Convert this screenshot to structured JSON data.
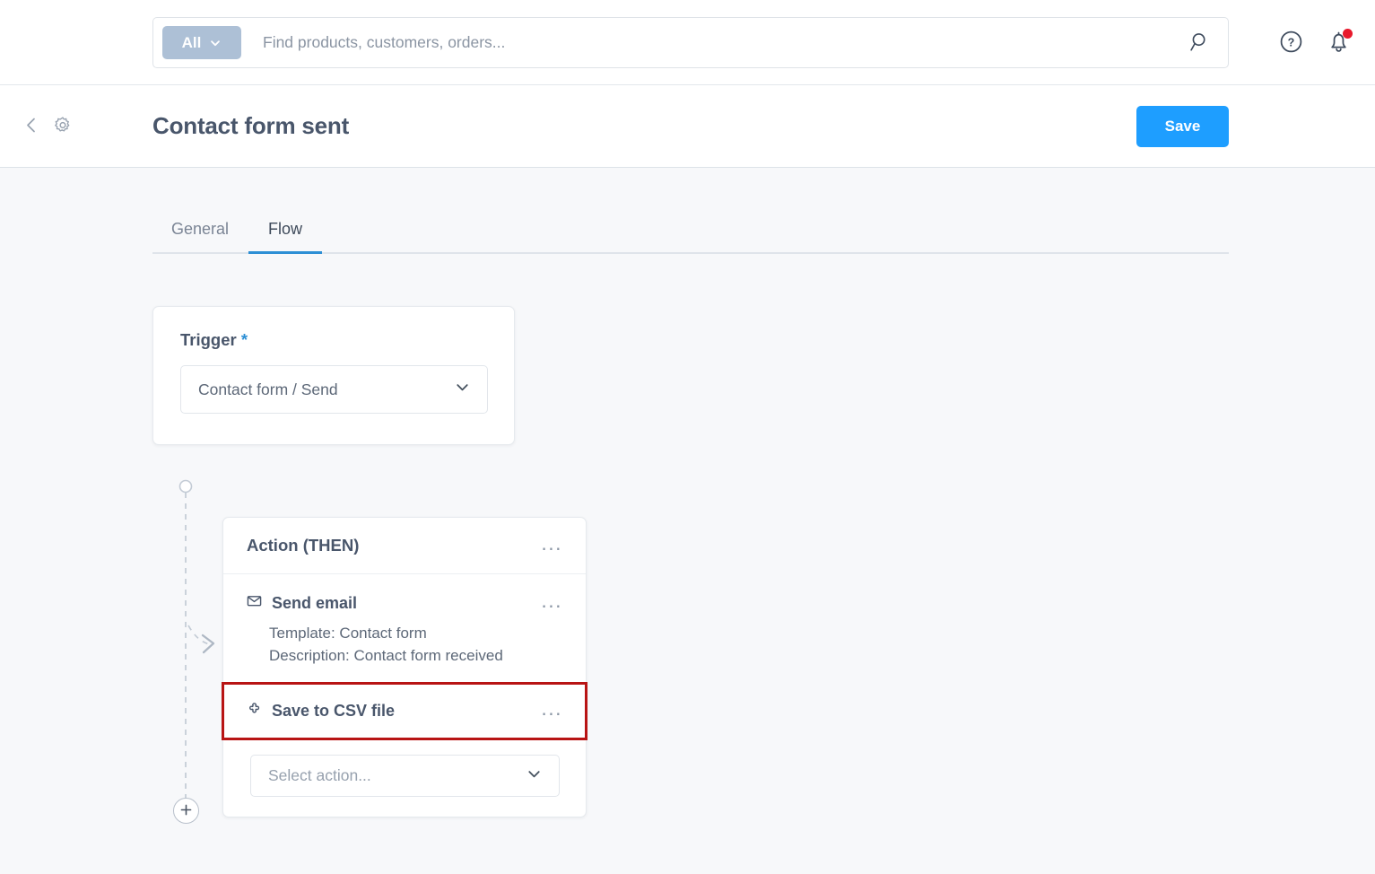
{
  "topbar": {
    "scope_label": "All",
    "scope_chevron_icon": "chevron-down-icon",
    "search_placeholder": "Find products, customers, orders...",
    "search_value": "",
    "search_icon": "search-icon",
    "help_icon": "help-circle-icon",
    "notifications_icon": "bell-icon",
    "notification_badge": ""
  },
  "pagehead": {
    "back_icon": "chevron-left-icon",
    "settings_icon": "gear-icon",
    "title": "Contact form sent",
    "save_label": "Save",
    "save_color": "#1e9eff"
  },
  "tabs": [
    {
      "label": "General",
      "active": false
    },
    {
      "label": "Flow",
      "active": true
    }
  ],
  "flow": {
    "trigger": {
      "label": "Trigger",
      "required_marker": "*",
      "select_value": "Contact form / Send",
      "chevron_icon": "chevron-down-icon"
    },
    "connector": {
      "add_step_icon": "plus-icon",
      "node_icon": "circle-node-icon",
      "arrow_icon": "arrow-right-icon"
    },
    "action_card": {
      "title": "Action (THEN)",
      "menu_icon": "ellipsis-icon",
      "menu_label": "...",
      "items": [
        {
          "icon": "envelope-icon",
          "name": "Send email",
          "menu_label": "...",
          "meta": [
            "Template: Contact form",
            "Description: Contact form received"
          ],
          "highlighted": false
        },
        {
          "icon": "puzzle-piece-icon",
          "name": "Save to CSV file",
          "menu_label": "...",
          "meta": [],
          "highlighted": true,
          "highlight_color": "#b81414"
        }
      ],
      "add_action_placeholder": "Select action...",
      "add_action_chevron_icon": "chevron-down-icon"
    }
  }
}
